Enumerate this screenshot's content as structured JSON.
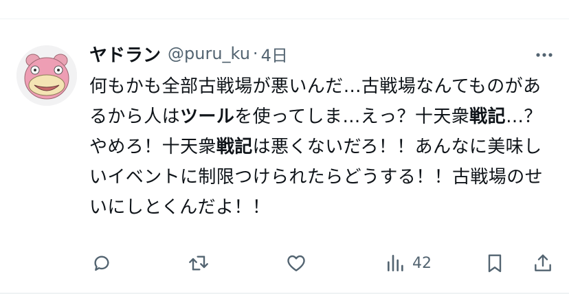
{
  "user": {
    "display_name": "ヤドラン",
    "handle": "@puru_ku",
    "separator": "·",
    "time": "4日"
  },
  "tweet": {
    "segments": [
      {
        "text": "何もかも全部古戦場が悪いんだ…古戦場なんてものがあるから人は",
        "bold": false
      },
      {
        "text": "ツール",
        "bold": true
      },
      {
        "text": "を使ってしま…えっ？十天衆",
        "bold": false
      },
      {
        "text": "戦記",
        "bold": true
      },
      {
        "text": "…？やめろ！十天衆",
        "bold": false
      },
      {
        "text": "戦記",
        "bold": true
      },
      {
        "text": "は悪くないだろ！！あんなに美味しいイベントに制限つけられたらどうする！！古戦場のせいにしとくんだよ！！",
        "bold": false
      }
    ]
  },
  "actions": {
    "reply": {
      "icon": "reply-icon"
    },
    "retweet": {
      "icon": "retweet-icon"
    },
    "like": {
      "icon": "heart-icon"
    },
    "views": {
      "icon": "analytics-icon",
      "count": "42"
    },
    "bookmark": {
      "icon": "bookmark-icon"
    },
    "share": {
      "icon": "share-icon"
    }
  },
  "colors": {
    "text_primary": "#0f1419",
    "text_secondary": "#536471",
    "divider": "#eff3f4",
    "avatar_pink": "#e9a3b4"
  }
}
